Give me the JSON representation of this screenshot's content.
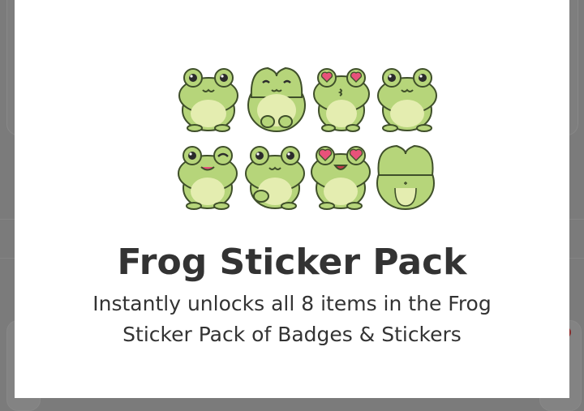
{
  "modal": {
    "title": "Frog Sticker Pack",
    "description": "Instantly unlocks all 8 items in the Frog Sticker Pack of Badges & Stickers"
  },
  "stickers": [
    {
      "name": "frog-happy-icon"
    },
    {
      "name": "frog-hug-icon"
    },
    {
      "name": "frog-heart-eyes-kiss-icon"
    },
    {
      "name": "frog-smile-icon"
    },
    {
      "name": "frog-wink-icon"
    },
    {
      "name": "frog-wave-icon"
    },
    {
      "name": "frog-heart-eyes-icon"
    },
    {
      "name": "frog-back-icon"
    }
  ],
  "colors": {
    "frog_body": "#b6d57a",
    "frog_belly": "#e4edb0",
    "outline": "#3f4f2a",
    "heart": "#e8527a",
    "title_text": "#333333"
  }
}
